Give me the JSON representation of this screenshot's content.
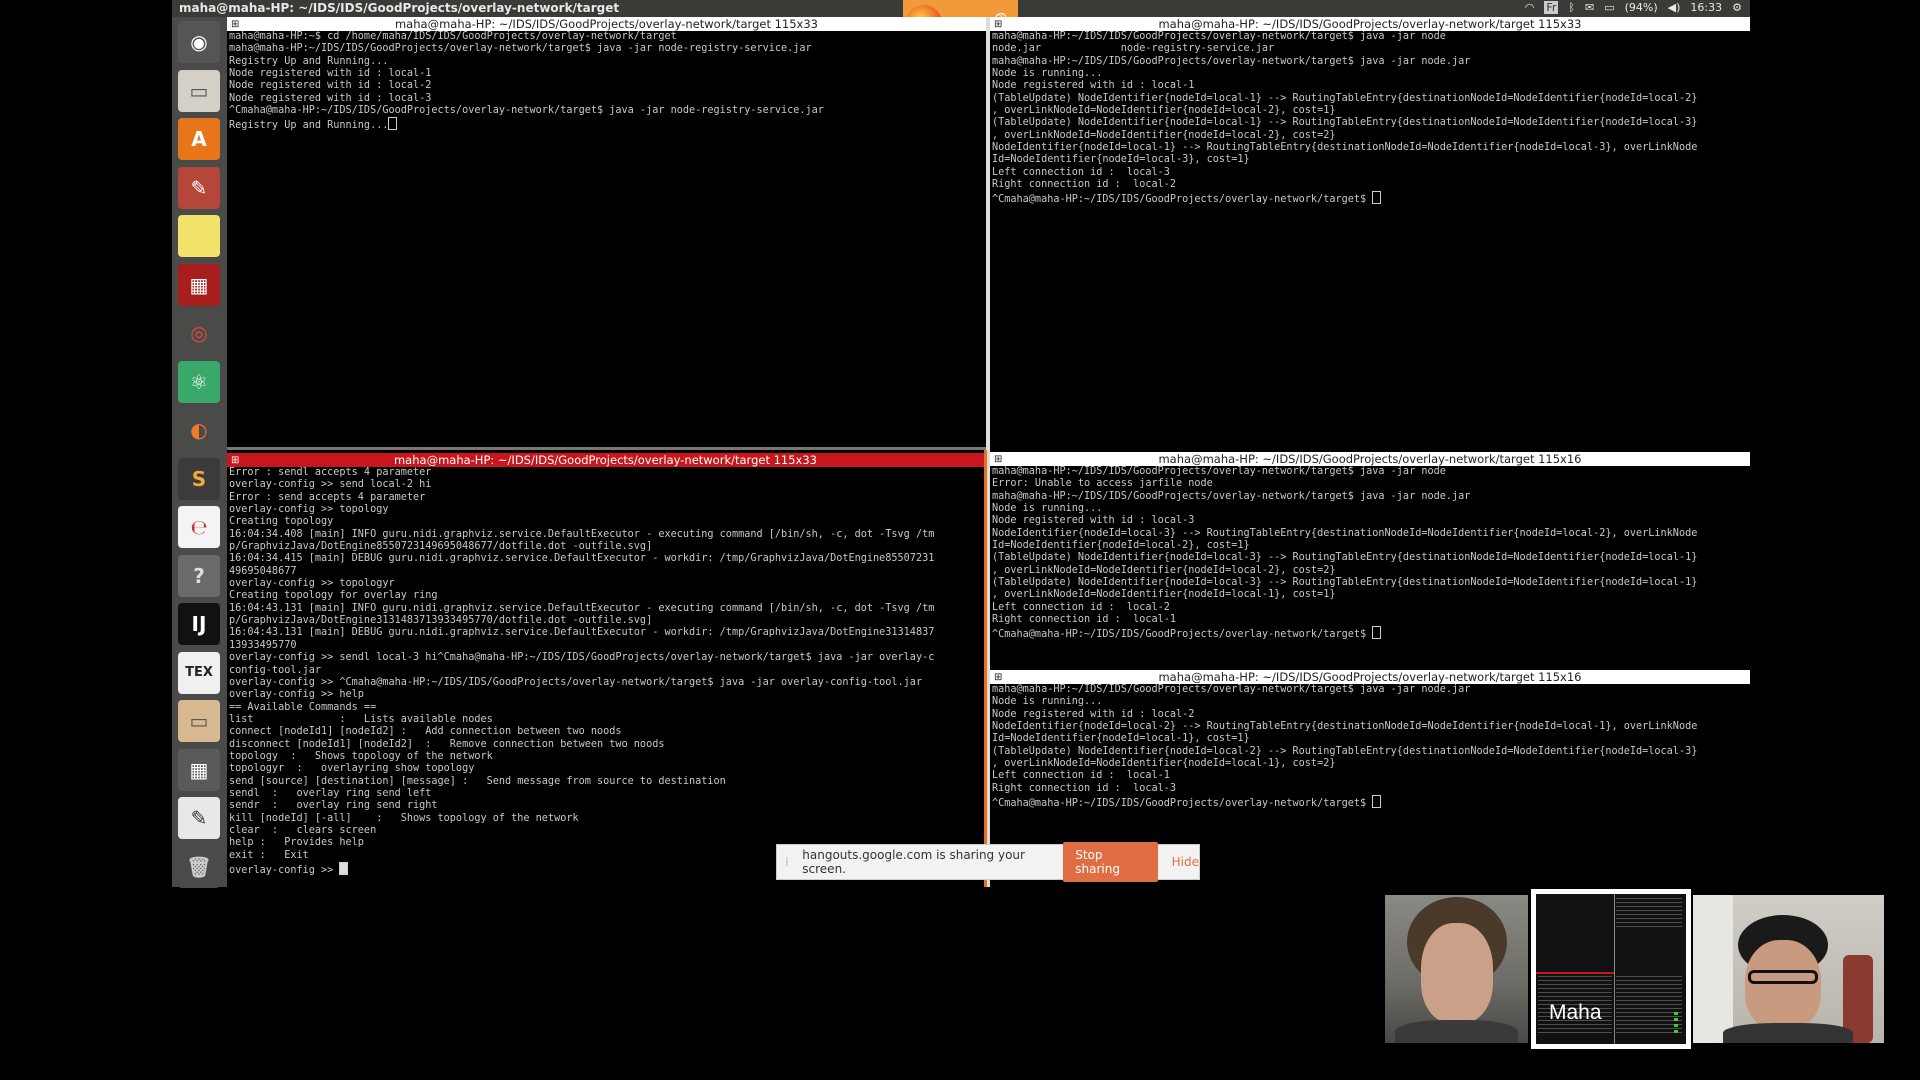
{
  "panel": {
    "title": "maha@maha-HP: ~/IDS/IDS/GoodProjects/overlay-network/target",
    "keyboard": "Fr",
    "battery": "(94%)",
    "clock": "16:33"
  },
  "launcher": {
    "items": [
      {
        "name": "dash-home-icon",
        "glyph": "◉",
        "bg": "#555555",
        "fg": "#ffffff"
      },
      {
        "name": "files-icon",
        "glyph": "▭",
        "bg": "#d4d0c8",
        "fg": "#555555"
      },
      {
        "name": "software-center-icon",
        "glyph": "A",
        "bg": "#e8751a",
        "fg": "#ffffff"
      },
      {
        "name": "system-settings-icon",
        "glyph": "✎",
        "bg": "#b4473a",
        "fg": "#ffffff"
      },
      {
        "name": "sticky-notes-icon",
        "glyph": "",
        "bg": "#f2e26a",
        "fg": "#333333"
      },
      {
        "name": "screen-recorder-icon",
        "glyph": "▦",
        "bg": "#a81e1e",
        "fg": "#ffffff"
      },
      {
        "name": "chrome-icon",
        "glyph": "◎",
        "bg": "#4a4a48",
        "fg": "#e44a3a"
      },
      {
        "name": "atom-icon",
        "glyph": "⚛",
        "bg": "#3aa86a",
        "fg": "#ffffff"
      },
      {
        "name": "firefox-icon",
        "glyph": "◐",
        "bg": "#4a4a48",
        "fg": "#f07b2a"
      },
      {
        "name": "sublime-text-icon",
        "glyph": "S",
        "bg": "#3b3b3b",
        "fg": "#f2a83a"
      },
      {
        "name": "document-viewer-icon",
        "glyph": "℮",
        "bg": "#f4f4f4",
        "fg": "#c83232"
      },
      {
        "name": "help-icon",
        "glyph": "?",
        "bg": "#6a6a6a",
        "fg": "#dddddd"
      },
      {
        "name": "intellij-icon",
        "glyph": "IJ",
        "bg": "#111111",
        "fg": "#ffffff"
      },
      {
        "name": "texmaker-icon",
        "glyph": "TEX",
        "bg": "#f0f0f0",
        "fg": "#222222"
      },
      {
        "name": "archive-manager-icon",
        "glyph": "▭",
        "bg": "#d8b890",
        "fg": "#555555"
      },
      {
        "name": "calculator-icon",
        "glyph": "▦",
        "bg": "#5a5a5a",
        "fg": "#ffffff"
      },
      {
        "name": "text-editor-icon",
        "glyph": "✎",
        "bg": "#e8e8e8",
        "fg": "#333333"
      },
      {
        "name": "trash-icon",
        "glyph": "🗑",
        "bg": "#4a4a48",
        "fg": "#cccccc"
      }
    ]
  },
  "terminals": {
    "top_left": {
      "title": "maha@maha-HP: ~/IDS/IDS/GoodProjects/overlay-network/target 115x33",
      "lines": [
        "maha@maha-HP:~$ cd /home/maha/IDS/IDS/GoodProjects/overlay-network/target",
        "maha@maha-HP:~/IDS/IDS/GoodProjects/overlay-network/target$ java -jar node-registry-service.jar",
        "Registry Up and Running...",
        "Node registered with id : local-1",
        "Node registered with id : local-2",
        "Node registered with id : local-3",
        "^Cmaha@maha-HP:~/IDS/IDS/GoodProjects/overlay-network/target$ java -jar node-registry-service.jar",
        "Registry Up and Running..."
      ]
    },
    "top_right": {
      "title": "maha@maha-HP: ~/IDS/IDS/GoodProjects/overlay-network/target 115x33",
      "lines": [
        "maha@maha-HP:~/IDS/IDS/GoodProjects/overlay-network/target$ java -jar node",
        "node.jar             node-registry-service.jar",
        "maha@maha-HP:~/IDS/IDS/GoodProjects/overlay-network/target$ java -jar node.jar",
        "Node is running...",
        "Node registered with id : local-1",
        "(TableUpdate) NodeIdentifier{nodeId=local-1} --> RoutingTableEntry{destinationNodeId=NodeIdentifier{nodeId=local-2}",
        ", overLinkNodeId=NodeIdentifier{nodeId=local-2}, cost=1}",
        "(TableUpdate) NodeIdentifier{nodeId=local-1} --> RoutingTableEntry{destinationNodeId=NodeIdentifier{nodeId=local-3}",
        ", overLinkNodeId=NodeIdentifier{nodeId=local-2}, cost=2}",
        "NodeIdentifier{nodeId=local-1} --> RoutingTableEntry{destinationNodeId=NodeIdentifier{nodeId=local-3}, overLinkNode",
        "Id=NodeIdentifier{nodeId=local-3}, cost=1}",
        "Left connection id :  local-3",
        "Right connection id :  local-2",
        "^Cmaha@maha-HP:~/IDS/IDS/GoodProjects/overlay-network/target$ "
      ]
    },
    "bottom_left": {
      "title": "maha@maha-HP: ~/IDS/IDS/GoodProjects/overlay-network/target 115x33",
      "lines": [
        "Error : sendl accepts 4 parameter",
        "overlay-config >> send local-2 hi",
        "Error : send accepts 4 parameter",
        "overlay-config >> topology",
        "Creating topology",
        "16:04:34.408 [main] INFO guru.nidi.graphviz.service.DefaultExecutor - executing command [/bin/sh, -c, dot -Tsvg /tm",
        "p/GraphvizJava/DotEngine855072314969504867​7/dotfile.dot -outfile.svg]",
        "16:04:34.415 [main] DEBUG guru.nidi.graphviz.service.DefaultExecutor - workdir: /tmp/GraphvizJava/DotEngine85507231",
        "49695048677",
        "overlay-config >> topologyr",
        "Creating topology for overlay ring",
        "16:04:43.131 [main] INFO guru.nidi.graphviz.service.DefaultExecutor - executing command [/bin/sh, -c, dot -Tsvg /tm",
        "p/GraphvizJava/DotEngine313148371393349577​0/dotfile.dot -outfile.svg]",
        "16:04:43.131 [main] DEBUG guru.nidi.graphviz.service.DefaultExecutor - workdir: /tmp/GraphvizJava/DotEngine31314837",
        "13933495770",
        "overlay-config >> sendl local-3 hi^Cmaha@maha-HP:~/IDS/IDS/GoodProjects/overlay-network/target$ java -jar overlay-c",
        "config-tool.jar",
        "overlay-config >> ^Cmaha@maha-HP:~/IDS/IDS/GoodProjects/overlay-network/target$ java -jar overlay-config-tool.jar",
        "overlay-config >> help",
        "== Available Commands ==",
        "list              :   Lists available nodes",
        "connect [nodeId1] [nodeId2] :   Add connection between two noods",
        "disconnect [nodeId1] [nodeId2]  :   Remove connection between two noods",
        "topology  :   Shows topology of the network",
        "topologyr  :   overlayring show topology",
        "send [source] [destination] [message] :   Send message from source to destination",
        "sendl  :   overlay ring send left",
        "sendr  :   overlay ring send right",
        "kill [nodeId] [-all]    :   Shows topology of the network",
        "clear  :   clears screen",
        "help :   Provides help",
        "exit :   Exit",
        "overlay-config >> "
      ]
    },
    "mid_right": {
      "title": "maha@maha-HP: ~/IDS/IDS/GoodProjects/overlay-network/target 115x16",
      "lines": [
        "maha@maha-HP:~/IDS/IDS/GoodProjects/overlay-network/target$ java -jar node",
        "Error: Unable to access jarfile node",
        "maha@maha-HP:~/IDS/IDS/GoodProjects/overlay-network/target$ java -jar node.jar",
        "Node is running...",
        "Node registered with id : local-3",
        "NodeIdentifier{nodeId=local-3} --> RoutingTableEntry{destinationNodeId=NodeIdentifier{nodeId=local-2}, overLinkNode",
        "Id=NodeIdentifier{nodeId=local-2}, cost=1}",
        "(TableUpdate) NodeIdentifier{nodeId=local-3} --> RoutingTableEntry{destinationNodeId=NodeIdentifier{nodeId=local-1}",
        ", overLinkNodeId=NodeIdentifier{nodeId=local-2}, cost=2}",
        "(TableUpdate) NodeIdentifier{nodeId=local-3} --> RoutingTableEntry{destinationNodeId=NodeIdentifier{nodeId=local-1}",
        ", overLinkNodeId=NodeIdentifier{nodeId=local-1}, cost=1}",
        "Left connection id :  local-2",
        "Right connection id :  local-1",
        "^Cmaha@maha-HP:~/IDS/IDS/GoodProjects/overlay-network/target$ "
      ]
    },
    "bottom_right": {
      "title": "maha@maha-HP: ~/IDS/IDS/GoodProjects/overlay-network/target 115x16",
      "lines": [
        "maha@maha-HP:~/IDS/IDS/GoodProjects/overlay-network/target$ java -jar node.jar",
        "Node is running...",
        "Node registered with id : local-2",
        "NodeIdentifier{nodeId=local-2} --> RoutingTableEntry{destinationNodeId=NodeIdentifier{nodeId=local-1}, overLinkNode",
        "Id=NodeIdentifier{nodeId=local-1}, cost=1}",
        "(TableUpdate) NodeIdentifier{nodeId=local-2} --> RoutingTableEntry{destinationNodeId=NodeIdentifier{nodeId=local-3}",
        ", overLinkNodeId=NodeIdentifier{nodeId=local-1}, cost=2}",
        "Left connection id :  local-1",
        "Right connection id :  local-3",
        "^Cmaha@maha-HP:~/IDS/IDS/GoodProjects/overlay-network/target$ "
      ]
    }
  },
  "share_bar": {
    "message": "hangouts.google.com is sharing your screen.",
    "stop_label": "Stop sharing",
    "hide_label": "Hide"
  },
  "video": {
    "name_label": "Maha"
  },
  "colors": {
    "active_titlebar": "#c8161d",
    "accent": "#e06e44"
  }
}
